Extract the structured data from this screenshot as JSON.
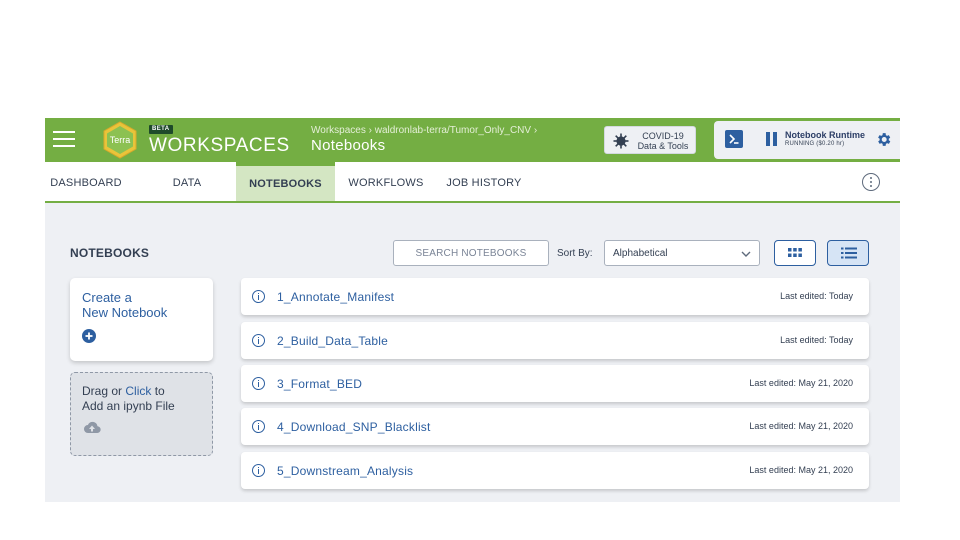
{
  "colors": {
    "brand_green": "#74ae43",
    "link_blue": "#2d5fa0",
    "app_background": "#eef0f4",
    "active_tab_bg": "#d4e6c3"
  },
  "header": {
    "logo_text": "Terra",
    "beta_badge": "BETA",
    "app_name": "WORKSPACES",
    "breadcrumb": "Workspaces › waldronlab-terra/Tumor_Only_CNV ›",
    "page_title": "Notebooks",
    "covid_button": {
      "icon": "virus-icon",
      "line1": "COVID-19",
      "line2": "Data & Tools"
    },
    "runtime": {
      "terminal_icon": "terminal-icon",
      "pause_icon": "pause-icon",
      "title": "Notebook Runtime",
      "status": "RUNNING ($0.20 hr)",
      "settings_icon": "gear-icon"
    }
  },
  "tabs": [
    {
      "label": "DASHBOARD",
      "active": false
    },
    {
      "label": "DATA",
      "active": false
    },
    {
      "label": "NOTEBOOKS",
      "active": true
    },
    {
      "label": "WORKFLOWS",
      "active": false
    },
    {
      "label": "JOB HISTORY",
      "active": false
    }
  ],
  "tab_menu_icon": "more-vertical-icon",
  "notebooks_section": {
    "title": "NOTEBOOKS",
    "search_placeholder": "SEARCH NOTEBOOKS",
    "sort_label": "Sort By:",
    "sort_value": "Alphabetical",
    "view_modes": [
      {
        "icon": "grid-view-icon",
        "active": false
      },
      {
        "icon": "list-view-icon",
        "active": true
      }
    ],
    "create_card": {
      "line1": "Create a",
      "line2": "New Notebook",
      "icon": "plus-circle-icon"
    },
    "upload_card": {
      "prefix": "Drag or ",
      "link": "Click",
      "suffix": " to",
      "line2": "Add an ipynb File",
      "icon": "cloud-upload-icon"
    },
    "notebooks": [
      {
        "name": "1_Annotate_Manifest",
        "edited": "Last edited: Today"
      },
      {
        "name": "2_Build_Data_Table",
        "edited": "Last edited: Today"
      },
      {
        "name": "3_Format_BED",
        "edited": "Last edited: May 21, 2020"
      },
      {
        "name": "4_Download_SNP_Blacklist",
        "edited": "Last edited: May 21, 2020"
      },
      {
        "name": "5_Downstream_Analysis",
        "edited": "Last edited: May 21, 2020"
      }
    ]
  }
}
